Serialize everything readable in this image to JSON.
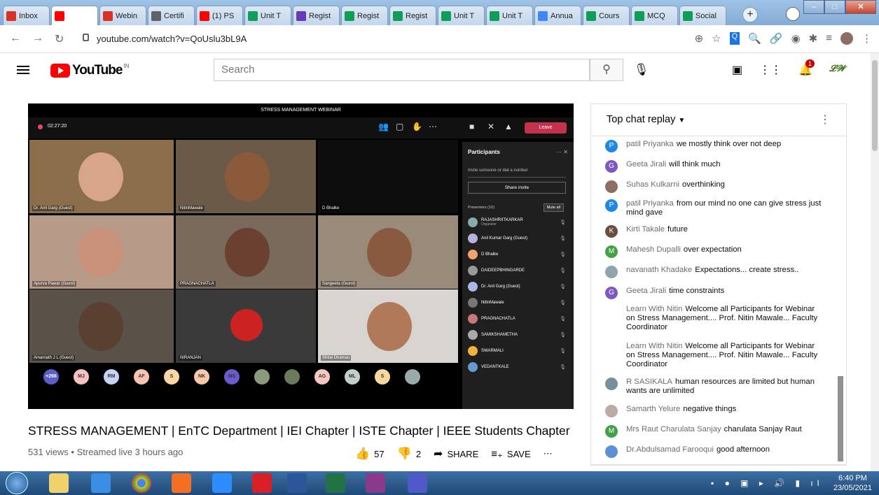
{
  "browser": {
    "tabs": [
      {
        "label": "Inbox",
        "color": "#d93025"
      },
      {
        "label": "",
        "color": "#ff0000"
      },
      {
        "label": "Webin",
        "color": "#d93025"
      },
      {
        "label": "Certifi",
        "color": "#5f6368"
      },
      {
        "label": "(1) PS",
        "color": "#ff0000"
      },
      {
        "label": "Unit T",
        "color": "#0f9d58"
      },
      {
        "label": "Regist",
        "color": "#673ab7"
      },
      {
        "label": "Regist",
        "color": "#0f9d58"
      },
      {
        "label": "Regist",
        "color": "#0f9d58"
      },
      {
        "label": "Unit T",
        "color": "#0f9d58"
      },
      {
        "label": "Unit T",
        "color": "#0f9d58"
      },
      {
        "label": "Annua",
        "color": "#4285f4"
      },
      {
        "label": "Cours",
        "color": "#0f9d58"
      },
      {
        "label": "MCQ",
        "color": "#0f9d58"
      },
      {
        "label": "Social",
        "color": "#0f9d58"
      }
    ],
    "url": "youtube.com/watch?v=QoUslu3bL9A"
  },
  "yt": {
    "logo_text": "YouTube",
    "region": "IN",
    "search_placeholder": "Search",
    "notif_count": "1"
  },
  "teams": {
    "window_title": "STRESS MANAGEMENT WEBINAR",
    "rec_time": "02:27:20",
    "leave_label": "Leave",
    "tiles": [
      {
        "label": "Dr. Anil Garg (Guest)"
      },
      {
        "label": "NitinMawale"
      },
      {
        "label": "D Bhalke"
      },
      {
        "label": "Apurva Pawar (Guest)"
      },
      {
        "label": "PRAGNACHATLA"
      },
      {
        "label": "Sangeeta (Guest)"
      },
      {
        "label": "Amarnath J L (Guest)"
      },
      {
        "label": "NIRANJAN"
      },
      {
        "label": "Shital Dhamao"
      }
    ],
    "thumbs": [
      "+266",
      "MJ",
      "RM",
      "AF",
      "S",
      "NK",
      "MS",
      "",
      "",
      "AG",
      "ML",
      "S",
      ""
    ],
    "participants_title": "Participants",
    "invite_placeholder": "Invite someone or dial a number",
    "share_invite": "Share invite",
    "presenters_label": "Presenters (10)",
    "mute_all": "Mute all",
    "people": [
      {
        "name": "RAJASHRIITKARKAR",
        "sub": "Organizer",
        "color": "#8aa"
      },
      {
        "name": "Anil Kumar Garg (Guest)",
        "sub": "",
        "color": "#b9b0e0"
      },
      {
        "name": "D Bhalke",
        "sub": "",
        "color": "#f2a36b"
      },
      {
        "name": "DAIDEEPBHINGARDE",
        "sub": "",
        "color": "#999"
      },
      {
        "name": "Dr. Anil Garg (Guest)",
        "sub": "",
        "color": "#aab8e8"
      },
      {
        "name": "NitinMawale",
        "sub": "",
        "color": "#777"
      },
      {
        "name": "PRAGNACHATLA",
        "sub": "",
        "color": "#c77"
      },
      {
        "name": "SAMIKSHAMETHA",
        "sub": "",
        "color": "#aaa"
      },
      {
        "name": "SWARMALI",
        "sub": "",
        "color": "#f0b23a"
      },
      {
        "name": "VEDANTKALE",
        "sub": "",
        "color": "#6699cc"
      }
    ]
  },
  "video_meta": {
    "title": "STRESS MANAGEMENT | EnTC Department | IEI Chapter | ISTE Chapter | IEEE Students Chapter",
    "views": "531 views • Streamed live 3 hours ago",
    "likes": "57",
    "dislikes": "2",
    "share": "SHARE",
    "save": "SAVE"
  },
  "chat": {
    "header": "Top chat replay",
    "messages": [
      {
        "initial": "P",
        "color": "#1e88e5",
        "author": "patil Priyanka",
        "text": "we mostly think over not deep"
      },
      {
        "initial": "G",
        "color": "#7e57c2",
        "author": "Geeta Jirali",
        "text": "will think much"
      },
      {
        "initial": "",
        "color": "#8d6e63",
        "author": "Suhas Kulkarni",
        "text": "overthinking"
      },
      {
        "initial": "P",
        "color": "#1e88e5",
        "author": "patil Priyanka",
        "text": "from our mind no one can give stress just mind gave"
      },
      {
        "initial": "K",
        "color": "#6d4c41",
        "author": "Kirti Takale",
        "text": "future"
      },
      {
        "initial": "M",
        "color": "#43a047",
        "author": "Mahesh Dupalli",
        "text": "over expectation"
      },
      {
        "initial": "",
        "color": "#90a4ae",
        "author": "navanath Khadake",
        "text": "Expectations... create stress.."
      },
      {
        "initial": "G",
        "color": "#7e57c2",
        "author": "Geeta Jirali",
        "text": "time constraints"
      },
      {
        "initial": "",
        "color": "#ffffff",
        "author": "Learn With Nitin",
        "text": "Welcome all Participants for Webinar on Stress Management.... Prof. Nitin Mawale... Faculty Coordinator"
      },
      {
        "initial": "",
        "color": "#ffffff",
        "author": "Learn With Nitin",
        "text": "Welcome all Participants for Webinar on Stress Management.... Prof. Nitin Mawale... Faculty Coordinator"
      },
      {
        "initial": "",
        "color": "#78909c",
        "author": "R SASIKALA",
        "text": "human resources are limited but human wants are unlimited"
      },
      {
        "initial": "",
        "color": "#bcaaa4",
        "author": "Samarth Yelure",
        "text": "negative things"
      },
      {
        "initial": "M",
        "color": "#43a047",
        "author": "Mrs Raut Charulata Sanjay",
        "text": "charulata Sanjay Raut"
      },
      {
        "initial": "",
        "color": "#5c8fd6",
        "author": "Dr.Abdulsamad Farooqui",
        "text": "good afternoon"
      }
    ]
  },
  "taskbar": {
    "time": "6:40 PM",
    "date": "23/05/2021"
  }
}
